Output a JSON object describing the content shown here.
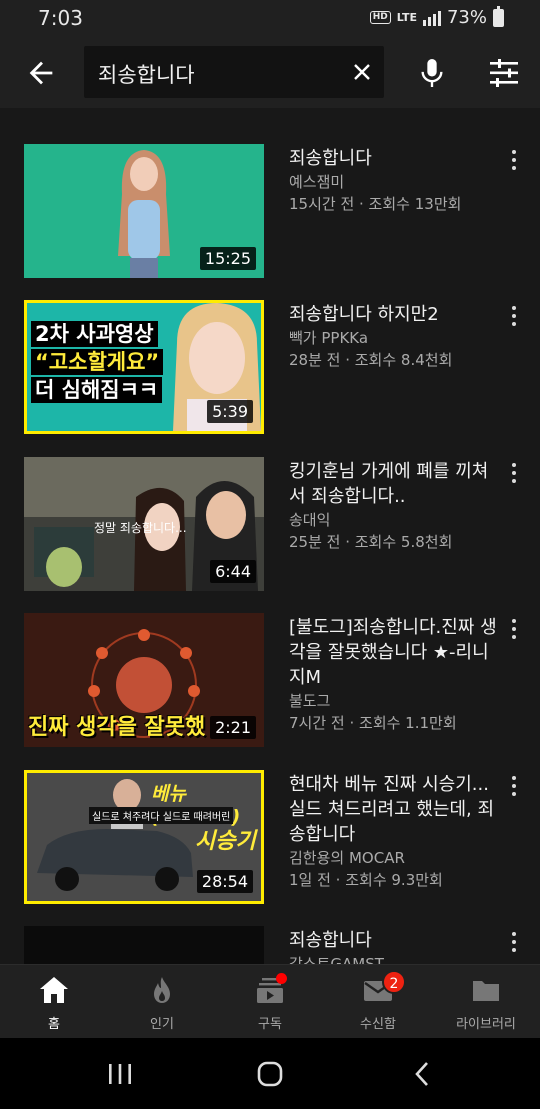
{
  "status": {
    "time": "7:03",
    "hd": "HD",
    "lte": "LTE",
    "battery": "73%"
  },
  "search": {
    "query": "죄송합니다"
  },
  "results": [
    {
      "title": "죄송합니다",
      "channel": "예스잼미",
      "meta": "15시간 전 · 조회수 13만회",
      "duration": "15:25"
    },
    {
      "title": "죄송합니다 하지만2",
      "channel": "빽가 PPKKa",
      "meta": "28분 전 · 조회수 8.4천회",
      "duration": "5:39",
      "thumb_text": [
        "2차 사과영상",
        "“고소할게요”",
        "더 심해짐ㅋㅋ"
      ]
    },
    {
      "title": "킹기훈님 가게에 폐를 끼쳐서 죄송합니다..",
      "channel": "송대익",
      "meta": "25분 전 · 조회수 5.8천회",
      "duration": "6:44",
      "thumb_text": [
        "정말 죄송합니다..."
      ]
    },
    {
      "title": "[불도그]죄송합니다.진짜 생각을 잘못했습니다 ★-리니지M",
      "channel": "불도그",
      "meta": "7시간 전 · 조회수 1.1만회",
      "duration": "2:21",
      "thumb_text": [
        "진짜 생각을 잘못했"
      ]
    },
    {
      "title": "현대차 베뉴 진짜 시승기...실드 쳐드리려고 했는데, 죄송합니다",
      "channel": "김한용의 MOCAR",
      "meta": "1일 전 · 조회수 9.3만회",
      "duration": "28:54",
      "thumb_text": [
        "베뉴(VENUE)",
        "실드로 쳐주려다 실드로 때려버린",
        "시승기"
      ]
    },
    {
      "title": "죄송합니다",
      "channel": "감스트GAMST",
      "meta": "",
      "duration": ""
    }
  ],
  "nav": [
    {
      "label": "홈",
      "icon": "home-icon",
      "active": true
    },
    {
      "label": "인기",
      "icon": "trending-flame-icon"
    },
    {
      "label": "구독",
      "icon": "subscriptions-icon"
    },
    {
      "label": "수신함",
      "icon": "inbox-mail-icon",
      "badge": "2"
    },
    {
      "label": "라이브러리",
      "icon": "library-folder-icon"
    }
  ],
  "colors": {
    "background": "#181818",
    "header": "#202020",
    "accent_red": "#ff0000",
    "text_secondary": "#aaaaaa"
  }
}
